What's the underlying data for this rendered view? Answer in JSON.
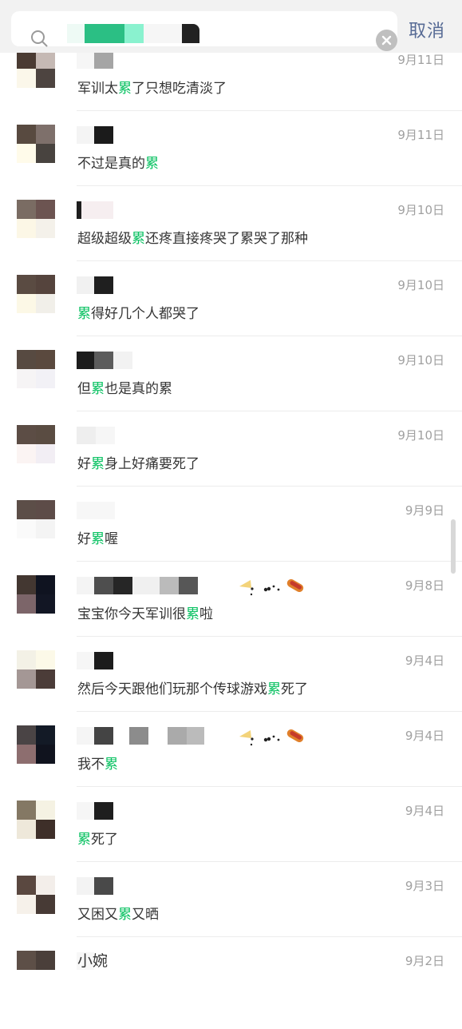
{
  "search": {
    "query_redacted": true,
    "cancel_label": "取消"
  },
  "colors": {
    "highlight": "#07c160",
    "cancel": "#576b95",
    "date": "#a0a0a0",
    "text": "#353535"
  },
  "icons": {
    "search": "search-icon",
    "clear": "clear-icon"
  },
  "results": [
    {
      "date": "9月11日",
      "parts": [
        "军训太",
        "累",
        "了只想吃清淡了"
      ]
    },
    {
      "date": "9月11日",
      "parts": [
        "不过是真的",
        "累",
        ""
      ]
    },
    {
      "date": "9月10日",
      "parts": [
        "超级超级",
        "累",
        "还疼直接疼哭了累哭了那种"
      ]
    },
    {
      "date": "9月10日",
      "parts": [
        "",
        "累",
        "得好几个人都哭了"
      ]
    },
    {
      "date": "9月10日",
      "parts": [
        "但",
        "累",
        "也是真的累"
      ]
    },
    {
      "date": "9月10日",
      "parts": [
        "好",
        "累",
        "身上好痛要死了"
      ]
    },
    {
      "date": "9月9日",
      "parts": [
        "好",
        "累",
        "喔"
      ]
    },
    {
      "date": "9月8日",
      "parts": [
        "宝宝你今天军训很",
        "累",
        "啦"
      ]
    },
    {
      "date": "9月4日",
      "parts": [
        "然后今天跟他们玩那个传球游戏",
        "累",
        "死了"
      ]
    },
    {
      "date": "9月4日",
      "parts": [
        "我不",
        "累",
        ""
      ]
    },
    {
      "date": "9月4日",
      "parts": [
        "",
        "累",
        "死了"
      ]
    },
    {
      "date": "9月3日",
      "parts": [
        "又困又",
        "累",
        "又晒"
      ]
    },
    {
      "date": "9月2日",
      "name": "小婉"
    }
  ]
}
